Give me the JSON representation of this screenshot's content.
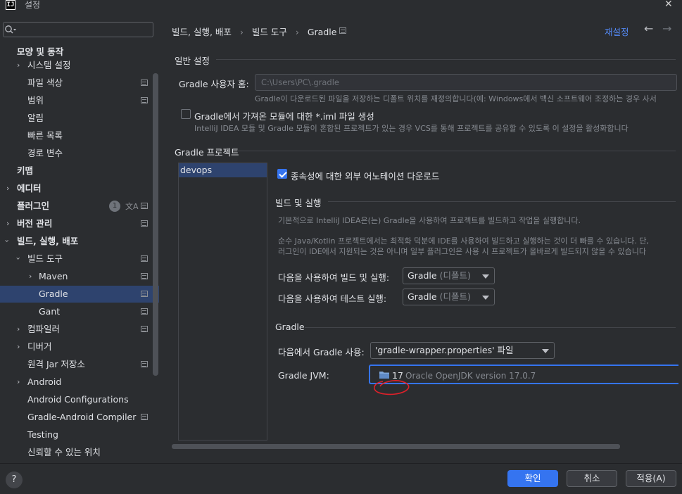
{
  "window": {
    "title": "설정",
    "close": "✕",
    "app_icon": "IJ"
  },
  "search": {
    "placeholder": "Q▾"
  },
  "sidebar": {
    "items": [
      {
        "label": "모양 및 동작"
      },
      {
        "label": "시스템 설정"
      },
      {
        "label": "파일 색상"
      },
      {
        "label": "범위"
      },
      {
        "label": "알림"
      },
      {
        "label": "빠른 목록"
      },
      {
        "label": "경로 변수"
      },
      {
        "label": "키맵"
      },
      {
        "label": "에디터"
      },
      {
        "label": "플러그인",
        "badge": "1"
      },
      {
        "label": "버전 관리"
      },
      {
        "label": "빌드, 실행, 배포"
      },
      {
        "label": "빌드 도구"
      },
      {
        "label": "Maven"
      },
      {
        "label": "Gradle"
      },
      {
        "label": "Gant"
      },
      {
        "label": "컴파일러"
      },
      {
        "label": "디버거"
      },
      {
        "label": "원격 Jar 저장소"
      },
      {
        "label": "Android"
      },
      {
        "label": "Android Configurations"
      },
      {
        "label": "Gradle-Android Compiler"
      },
      {
        "label": "Testing"
      },
      {
        "label": "신뢰할 수 있는 위치"
      }
    ]
  },
  "header": {
    "breadcrumb": [
      "빌드, 실행, 배포",
      "빌드 도구",
      "Gradle"
    ],
    "sep": "›",
    "reset": "재설정",
    "back": "←",
    "forward": "→"
  },
  "general": {
    "title": "일반 설정",
    "user_home_label": "Gradle 사용자 홈:",
    "user_home_value": "C:\\Users\\PC\\.gradle",
    "user_home_hint": "Gradle이 다운로드된 파일을 저장하는 디폴트 위치를 재정의합니다(예: Windows에서 백신 소프트웨어 조정하는 경우 사서",
    "iml_label": "Gradle에서 가져온 모듈에 대한 *.iml 파일 생성",
    "iml_hint": "IntelliJ IDEA 모듈 및 Gradle 모듈이 혼합된 프로젝트가 있는 경우 VCS를 통해 프로젝트를 공유할 수 있도록 이 설정을 활성화합니다"
  },
  "projects": {
    "title": "Gradle 프로젝트",
    "list": [
      "devops"
    ],
    "download_annotations": "종속성에 대한 외부 어노테이션 다운로드",
    "build_run": {
      "title": "빌드 및 실행",
      "desc1": "기본적으로 IntelliJ IDEA은(는) Gradle을 사용하여 프로젝트를 빌드하고 작업을 실행합니다.",
      "desc2": "순수 Java/Kotlin 프로젝트에서는 최적화 덕분에 IDE를 사용하여 빌드하고 실행하는 것이 더 빠를 수 있습니다. 단,",
      "desc3": "러그인이 IDE에서 지원되는 것은 아니며 일부 플러그인은 사용 시 프로젝트가 올바르게 빌드되지 않을 수 있습니다",
      "build_label": "다음을 사용하여 빌드 및 실행:",
      "build_value": "Gradle",
      "build_default": "(디폴트)",
      "test_label": "다음을 사용하여 테스트 실행:",
      "test_value": "Gradle",
      "test_default": "(디폴트)"
    },
    "gradle": {
      "title": "Gradle",
      "use_from_label": "다음에서 Gradle 사용:",
      "use_from_value": "'gradle-wrapper.properties' 파일",
      "jvm_label": "Gradle JVM:",
      "jvm_version": "17",
      "jvm_name": "Oracle OpenJDK version 17.0.7"
    }
  },
  "footer": {
    "help": "?",
    "ok": "확인",
    "cancel": "취소",
    "apply": "적용(A)"
  },
  "colors": {
    "accent": "#3574f0",
    "selection": "#2e436e",
    "annotation": "#e0202a"
  }
}
